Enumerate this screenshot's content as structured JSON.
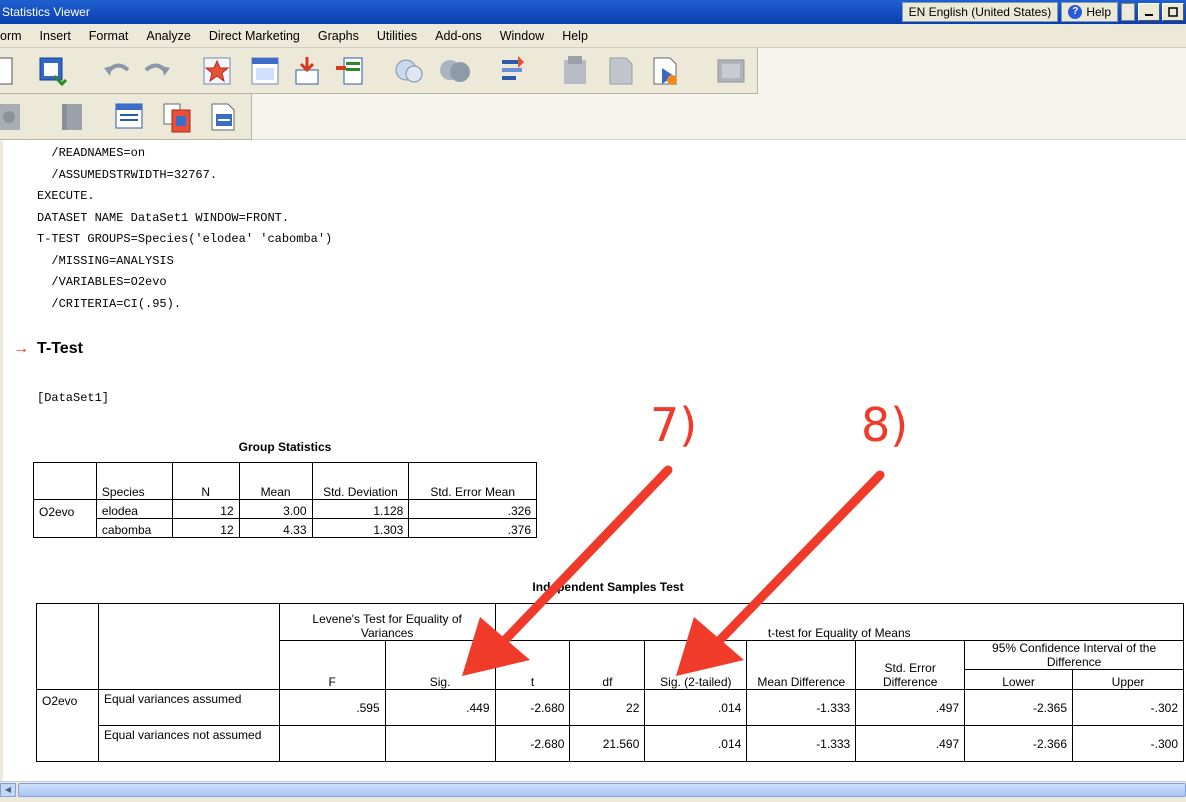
{
  "window": {
    "title": "Statistics Viewer",
    "language": "EN English (United States)",
    "help": "Help",
    "grip": "⁝"
  },
  "menu": [
    "orm",
    "Insert",
    "Format",
    "Analyze",
    "Direct Marketing",
    "Graphs",
    "Utilities",
    "Add-ons",
    "Window",
    "Help"
  ],
  "syntax_lines": [
    "  /READNAMES=on",
    "  /ASSUMEDSTRWIDTH=32767.",
    "EXECUTE.",
    "DATASET NAME DataSet1 WINDOW=FRONT.",
    "T-TEST GROUPS=Species('elodea' 'cabomba')",
    "  /MISSING=ANALYSIS",
    "  /VARIABLES=O2evo",
    "  /CRITERIA=CI(.95)."
  ],
  "output": {
    "heading": "T-Test",
    "heading_icon": "→",
    "dataset": "[DataSet1]"
  },
  "group_stats": {
    "title": "Group Statistics",
    "headers": [
      "Species",
      "N",
      "Mean",
      "Std. Deviation",
      "Std. Error Mean"
    ],
    "variable": "O2evo",
    "rows": [
      [
        "elodea",
        "12",
        "3.00",
        "1.128",
        ".326"
      ],
      [
        "cabomba",
        "12",
        "4.33",
        "1.303",
        ".376"
      ]
    ]
  },
  "indep_test": {
    "title": "Independent Samples Test",
    "levene_header": "Levene's Test for Equality of Variances",
    "ttest_header": "t-test for Equality of Means",
    "ci_header": "95% Confidence Interval of the Difference",
    "col_F": "F",
    "col_sig": "Sig.",
    "col_t": "t",
    "col_df": "df",
    "col_sig2": "Sig. (2-tailed)",
    "col_meandiff": "Mean Difference",
    "col_sediff": "Std. Error Difference",
    "col_lower": "Lower",
    "col_upper": "Upper",
    "variable": "O2evo",
    "rows": [
      {
        "label": "Equal variances assumed",
        "F": ".595",
        "sig": ".449",
        "t": "-2.680",
        "df": "22",
        "sig2": ".014",
        "md": "-1.333",
        "sed": ".497",
        "lower": "-2.365",
        "upper": "-.302"
      },
      {
        "label": "Equal variances not assumed",
        "F": "",
        "sig": "",
        "t": "-2.680",
        "df": "21.560",
        "sig2": ".014",
        "md": "-1.333",
        "sed": ".497",
        "lower": "-2.366",
        "upper": "-.300"
      }
    ]
  },
  "annotations": {
    "a7": "7)",
    "a8": "8)"
  },
  "colors": {
    "annotation": "#f03a2a",
    "titlebar": "#0a3fae"
  }
}
